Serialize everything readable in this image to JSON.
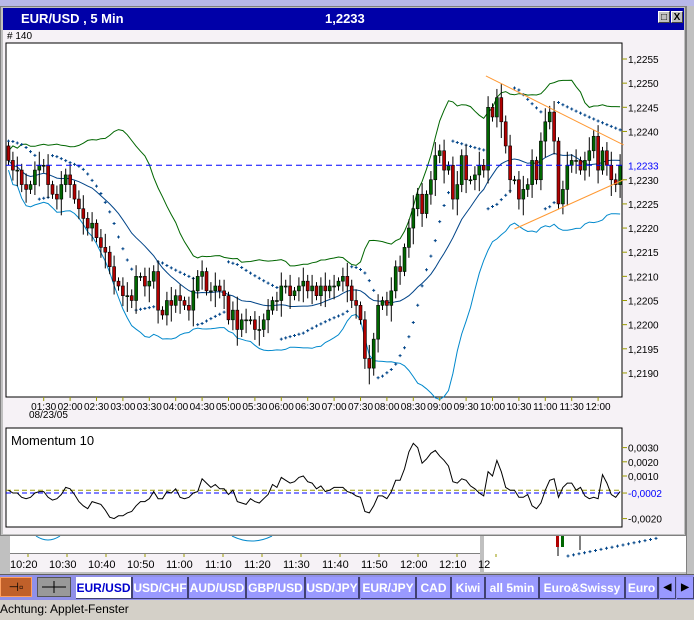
{
  "window": {
    "title": "EUR/USD , 5 Min",
    "current_price": "1,2233",
    "bar_count": "# 140",
    "buttons": {
      "maximize": "□",
      "close": "X"
    }
  },
  "chart_data": [
    {
      "type": "candlestick",
      "title": "",
      "date_label": "08/23/05",
      "x_tick_labels": [
        "01:30",
        "02:00",
        "02:30",
        "03:00",
        "03:30",
        "04:00",
        "04:30",
        "05:00",
        "05:30",
        "06:00",
        "06:30",
        "07:00",
        "07:30",
        "08:00",
        "08:30",
        "09:00",
        "09:30",
        "10:00",
        "10:30",
        "11:00",
        "11:30",
        "12:00"
      ],
      "y_tick_labels": [
        "1,2255",
        "1,2250",
        "1,2245",
        "1,2240",
        "1,2230",
        "1,2225",
        "1,2220",
        "1,2215",
        "1,2210",
        "1,2205",
        "1,2200",
        "1,2195",
        "1,2190"
      ],
      "y_ticks": [
        1.2255,
        1.225,
        1.2245,
        1.224,
        1.223,
        1.2225,
        1.222,
        1.2215,
        1.221,
        1.2205,
        1.22,
        1.2195,
        1.219
      ],
      "ylim": [
        1.21855,
        1.2259
      ],
      "current_price_line": {
        "value": 1.2233,
        "label": "1,2233",
        "color": "#0000ff"
      },
      "closes": [
        1.2234,
        1.2232,
        1.2232,
        1.2229,
        1.2228,
        1.2229,
        1.2232,
        1.2233,
        1.2233,
        1.2229,
        1.2227,
        1.2226,
        1.2229,
        1.2231,
        1.2229,
        1.2226,
        1.2224,
        1.2222,
        1.222,
        1.2221,
        1.2218,
        1.2216,
        1.2215,
        1.2212,
        1.2209,
        1.2208,
        1.2206,
        1.2206,
        1.2205,
        1.221,
        1.221,
        1.2208,
        1.2209,
        1.2211,
        1.2203,
        1.2202,
        1.2205,
        1.2204,
        1.2206,
        1.2205,
        1.2204,
        1.2203,
        1.2207,
        1.221,
        1.2211,
        1.2207,
        1.2207,
        1.2208,
        1.2207,
        1.2206,
        1.2201,
        1.2203,
        1.2199,
        1.2201,
        1.2201,
        1.2201,
        1.2199,
        1.2199,
        1.2201,
        1.2203,
        1.2205,
        1.2205,
        1.2208,
        1.2208,
        1.2206,
        1.2207,
        1.2208,
        1.2209,
        1.2207,
        1.2208,
        1.2206,
        1.2208,
        1.2207,
        1.2208,
        1.2208,
        1.2209,
        1.221,
        1.2208,
        1.2205,
        1.2204,
        1.2201,
        1.2193,
        1.2191,
        1.2197,
        1.2204,
        1.2205,
        1.2204,
        1.2207,
        1.2212,
        1.2211,
        1.2216,
        1.222,
        1.2224,
        1.2227,
        1.2223,
        1.2227,
        1.223,
        1.2235,
        1.2236,
        1.2232,
        1.2233,
        1.2226,
        1.2229,
        1.2235,
        1.223,
        1.223,
        1.2231,
        1.2233,
        1.2232,
        1.2245,
        1.2243,
        1.2247,
        1.2242,
        1.2237,
        1.223,
        1.223,
        1.2226,
        1.2228,
        1.2229,
        1.2234,
        1.223,
        1.2238,
        1.2242,
        1.2244,
        1.2238,
        1.2225,
        1.2228,
        1.2233,
        1.2234,
        1.2234,
        1.2232,
        1.2234,
        1.2236,
        1.2239,
        1.2232,
        1.2236,
        1.2233,
        1.223,
        1.2229,
        1.2233
      ],
      "first_open": 1.2237,
      "indicators": [
        "bollinger-bands",
        "moving-average",
        "parabolic-sar"
      ],
      "trendlines": [
        {
          "from": [
            108.5,
            1.22515
          ],
          "to": [
            139.8,
            1.22372
          ],
          "color": "#ff9933"
        },
        {
          "from": [
            115,
            1.22198
          ],
          "to": [
            139.8,
            1.223
          ],
          "color": "#ff9933"
        }
      ],
      "colors": {
        "up": "#006600",
        "down": "#b00000",
        "upper_band": "#006600",
        "middle_band": "#004488",
        "lower_band": "#0088cc",
        "sar": "#004488"
      }
    },
    {
      "type": "line",
      "title": "Momentum 10",
      "period": 10,
      "y_tick_labels": [
        "0,0030",
        "0,0020",
        "0,0010",
        "-0,0002",
        "-0,0020"
      ],
      "y_ticks": [
        0.003,
        0.002,
        0.001,
        -0.0002,
        -0.002
      ],
      "current_value": {
        "value": -0.0002,
        "label": "-0,0002",
        "color": "#0000ff"
      },
      "zero_line_color": "#999900"
    }
  ],
  "background_chart": {
    "x_tick_labels": [
      "10:20",
      "10:30",
      "10:40",
      "10:50",
      "11:00",
      "11:10",
      "11:20",
      "11:30",
      "11:40",
      "11:50",
      "12:00",
      "12:10",
      "12"
    ]
  },
  "toolbar": {
    "pin_button": "pin-icon",
    "crosshair_button": "crosshair-icon",
    "tabs": [
      "EUR/USD",
      "USD/CHF",
      "AUD/USD",
      "GBP/USD",
      "USD/JPY",
      "EUR/JPY",
      "CAD",
      "Kiwi",
      "all 5min",
      "Euro&Swissy",
      "Euro"
    ],
    "active_tab": "EUR/USD",
    "scroll_left": "◀",
    "scroll_right": "▶"
  },
  "status": {
    "text": "Achtung: Applet-Fenster"
  }
}
